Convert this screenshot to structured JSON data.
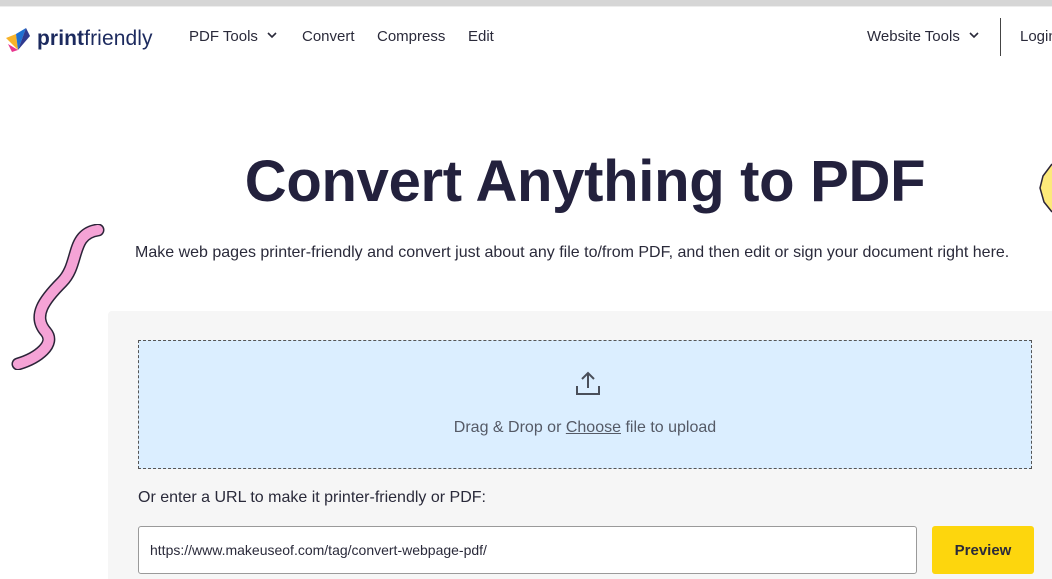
{
  "brand": {
    "print": "print",
    "friendly": "friendly"
  },
  "nav": {
    "pdf_tools": "PDF Tools",
    "convert": "Convert",
    "compress": "Compress",
    "edit": "Edit",
    "website_tools": "Website Tools",
    "login": "Login"
  },
  "hero": {
    "title": "Convert Anything to PDF",
    "subtitle": "Make web pages printer-friendly and convert just about any file to/from PDF, and then edit or sign your document right here."
  },
  "upload": {
    "prefix": "Drag & Drop or ",
    "choose": "Choose",
    "suffix": " file to upload"
  },
  "url_form": {
    "label": "Or enter a URL to make it printer-friendly or PDF:",
    "value": "https://www.makeuseof.com/tag/convert-webpage-pdf/",
    "button": "Preview"
  },
  "colors": {
    "accent_button": "#fdd60d",
    "dropzone": "#dbeeff",
    "title": "#23213d",
    "logo": "#1c2a5e"
  },
  "icons": [
    "logo-mark-icon",
    "chevron-down-icon",
    "upload-icon",
    "squiggle-decoration",
    "star-decoration"
  ]
}
